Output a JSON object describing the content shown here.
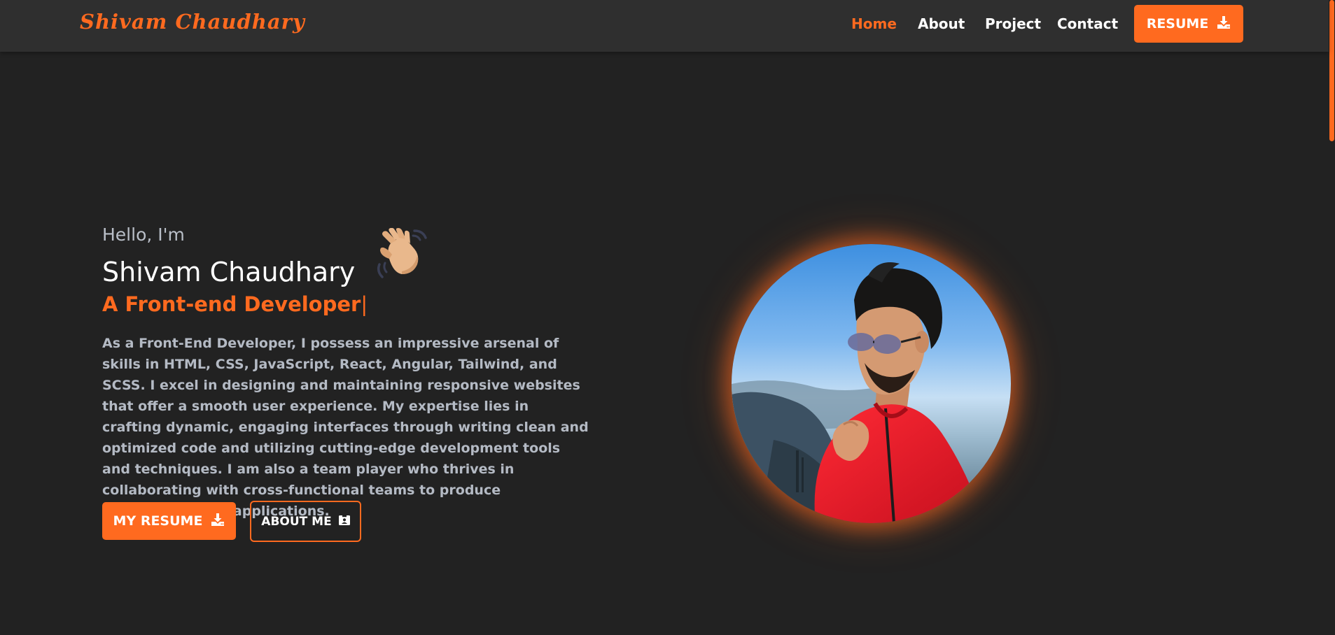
{
  "navbar": {
    "brand": "Shivam Chaudhary",
    "links": [
      {
        "label": "Home",
        "active": true
      },
      {
        "label": "About",
        "active": false
      },
      {
        "label": "Project",
        "active": false
      },
      {
        "label": "Contact",
        "active": false
      }
    ],
    "resume_label": "RESUME",
    "resume_icon": "download-icon"
  },
  "hero": {
    "greeting": "Hello, I'm",
    "wave_icon": "waving-hand-icon",
    "name": "Shivam Chaudhary",
    "role": "A Front-end Developer",
    "role_cursor": "|",
    "bio": "As a Front-End Developer, I possess an impressive arsenal of skills in HTML, CSS, JavaScript, React, Angular, Tailwind, and SCSS. I excel in designing and maintaining responsive websites that offer a smooth user experience. My expertise lies in crafting dynamic, engaging interfaces through writing clean and optimized code and utilizing cutting-edge development tools and techniques. I am also a team player who thrives in collaborating with cross-functional teams to produce outstanding web applications.",
    "primary_button": {
      "label": "MY RESUME",
      "icon": "download-icon"
    },
    "secondary_button": {
      "label": "ABOUT ME",
      "icon": "id-card-icon"
    },
    "photo": "profile-photo"
  },
  "colors": {
    "accent": "#ff6a1f",
    "background": "#222222",
    "navbar": "#2f2f2f",
    "text_muted": "#b4bac4"
  }
}
